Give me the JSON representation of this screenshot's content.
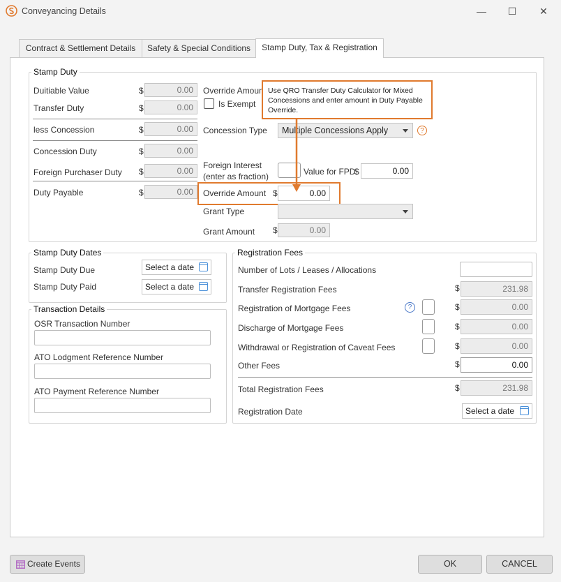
{
  "window": {
    "title": "Conveyancing Details",
    "minimize_glyph": "—",
    "maximize_glyph": "☐",
    "close_glyph": "✕"
  },
  "tabs": [
    {
      "label": "Contract & Settlement Details"
    },
    {
      "label": "Safety & Special Conditions"
    },
    {
      "label": "Stamp Duty, Tax & Registration"
    }
  ],
  "stamp_duty": {
    "title": "Stamp Duty",
    "currency": "$",
    "rows": [
      {
        "label": "Duitiable Value",
        "value": "0.00"
      },
      {
        "label": "Transfer Duty",
        "value": "0.00"
      },
      {
        "label": "less Concession",
        "value": "0.00"
      },
      {
        "label": "Concession Duty",
        "value": "0.00"
      },
      {
        "label": "Foreign Purchaser Duty",
        "value": "0.00"
      },
      {
        "label": "Duty Payable",
        "value": "0.00"
      }
    ],
    "override_amount_label_top": "Override Amount",
    "is_exempt_label": "Is Exempt",
    "concession_type_label": "Concession Type",
    "concession_type_value": "Multiple Concessions Apply",
    "foreign_interest_label_1": "Foreign Interest",
    "foreign_interest_label_2": "(enter as fraction)",
    "value_for_fpd_label": "Value for FPD",
    "value_for_fpd_value": "0.00",
    "override_amount_label": "Override Amount",
    "override_amount_value": "0.00",
    "grant_type_label": "Grant Type",
    "grant_amount_label": "Grant Amount",
    "grant_amount_value": "0.00",
    "help_glyph": "?"
  },
  "callout": {
    "text": "Use QRO Transfer Duty Calculator for Mixed Concessions and enter amount in Duty Payable Override."
  },
  "stamp_duty_dates": {
    "title": "Stamp Duty Dates",
    "due_label": "Stamp Duty Due",
    "paid_label": "Stamp Duty Paid",
    "date_placeholder": "Select a date"
  },
  "transaction_details": {
    "title": "Transaction Details",
    "osr_label": "OSR Transaction Number",
    "ato_lodgment_label": "ATO Lodgment Reference Number",
    "ato_payment_label": "ATO Payment Reference Number"
  },
  "registration_fees": {
    "title": "Registration Fees",
    "currency": "$",
    "lots_label": "Number of Lots / Leases / Allocations",
    "transfer_label": "Transfer Registration Fees",
    "transfer_value": "231.98",
    "mortgage_label": "Registration of Mortgage Fees",
    "mortgage_value": "0.00",
    "discharge_label": "Discharge of Mortgage Fees",
    "discharge_value": "0.00",
    "caveat_label": "Withdrawal or Registration of Caveat Fees",
    "caveat_value": "0.00",
    "other_label": "Other Fees",
    "other_value": "0.00",
    "total_label": "Total Registration Fees",
    "total_value": "231.98",
    "reg_date_label": "Registration Date",
    "date_placeholder": "Select a date",
    "help_glyph": "?"
  },
  "footer": {
    "create_events_label": "Create Events",
    "ok_label": "OK",
    "cancel_label": "CANCEL"
  },
  "colors": {
    "accent_orange": "#e07a2e",
    "help_blue": "#4a78c8",
    "calendar_blue": "#4a90d9",
    "create_events_icon": "#b36fc4"
  }
}
